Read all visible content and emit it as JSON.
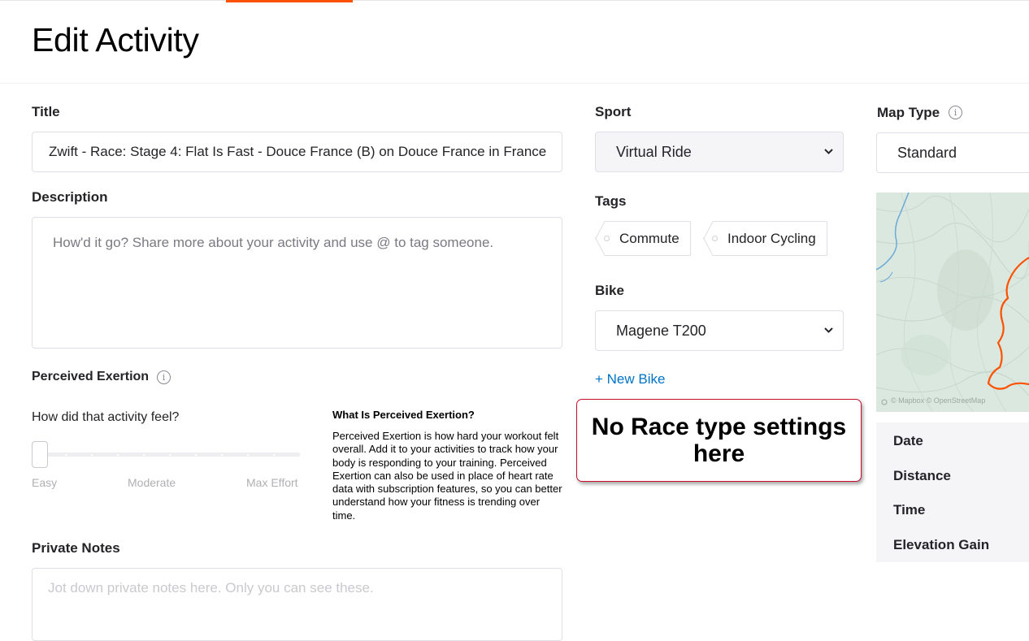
{
  "header": {
    "title": "Edit Activity"
  },
  "colors": {
    "accent": "#fc5200",
    "link": "#0073c5",
    "callout_border": "#c8102e",
    "route": "#fc5200"
  },
  "form": {
    "title": {
      "label": "Title",
      "value": "Zwift - Race: Stage 4: Flat Is Fast - Douce France (B) on Douce France in France"
    },
    "description": {
      "label": "Description",
      "placeholder": "How'd it go? Share more about your activity and use @ to tag someone."
    },
    "perceived_exertion": {
      "label": "Perceived Exertion",
      "info_icon": "info-icon",
      "question": "How did that activity feel?",
      "value": 0,
      "scale": {
        "min_label": "Easy",
        "mid_label": "Moderate",
        "max_label": "Max Effort"
      },
      "info_heading": "What Is Perceived Exertion?",
      "info_text": "Perceived Exertion is how hard your workout felt overall. Add it to your activities to track how your body is responding to your training. Perceived Exertion can also be used in place of heart rate data with subscription features, so you can better understand how your fitness is trending over time."
    },
    "private_notes": {
      "label": "Private Notes",
      "placeholder": "Jot down private notes here. Only you can see these."
    },
    "sport": {
      "label": "Sport",
      "selected": "Virtual Ride"
    },
    "tags": {
      "label": "Tags",
      "items": [
        "Commute",
        "Indoor Cycling"
      ]
    },
    "bike": {
      "label": "Bike",
      "selected": "Magene T200",
      "new_bike_link": "+ New Bike"
    },
    "map_type": {
      "label": "Map Type",
      "info_icon": "info-icon",
      "selected": "Standard",
      "attribution": "© Mapbox © OpenStreetMap"
    }
  },
  "stats": {
    "items": [
      "Date",
      "Distance",
      "Time",
      "Elevation Gain"
    ]
  },
  "annotation": {
    "text": "No Race type settings here"
  }
}
